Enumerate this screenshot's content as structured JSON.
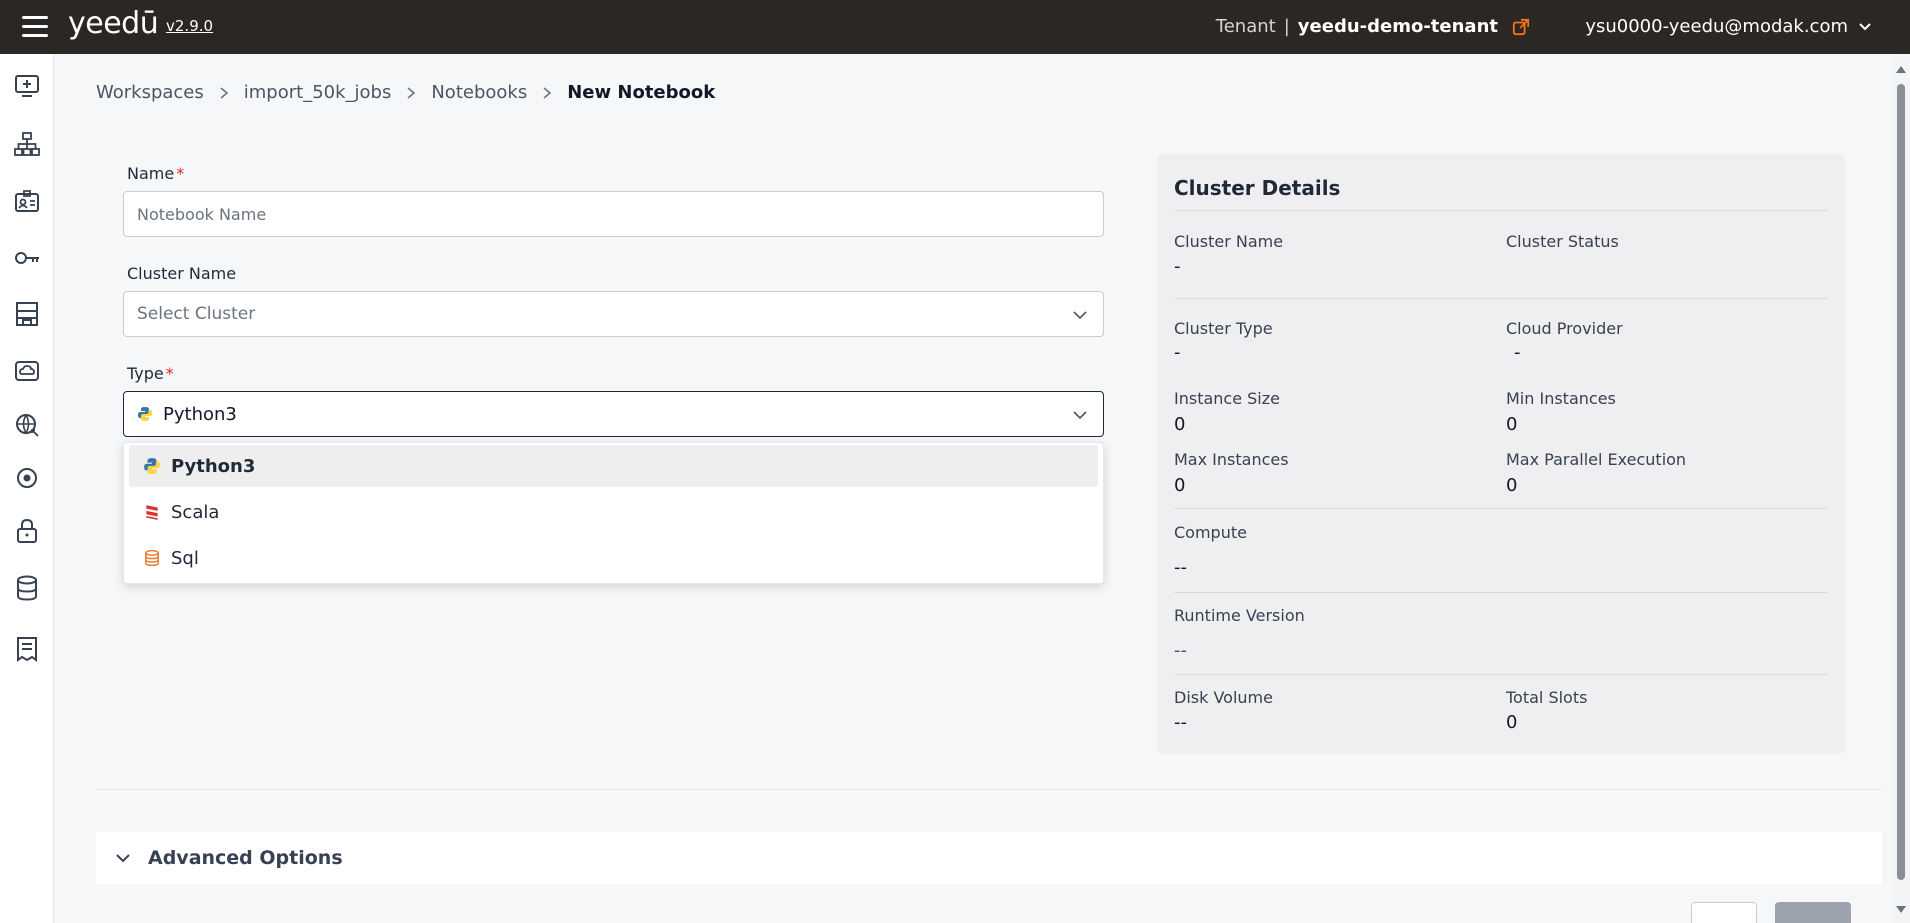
{
  "topbar": {
    "logo": "yeedū",
    "version": "v2.9.0",
    "tenant_label": "Tenant",
    "tenant_separator": "|",
    "tenant_name": "yeedu-demo-tenant",
    "user_email": "ysu0000-yeedu@modak.com"
  },
  "sidebar": {
    "icons": [
      "new-workspace-icon",
      "sitemap-icon",
      "id-card-icon",
      "key-icon",
      "building-icon",
      "cloud-icon",
      "globe-icon",
      "target-icon",
      "lock-icon",
      "database-icon",
      "receipt-icon"
    ]
  },
  "breadcrumb": {
    "items": [
      "Workspaces",
      "import_50k_jobs",
      "Notebooks"
    ],
    "current": "New Notebook"
  },
  "form": {
    "name_label": "Name",
    "name_placeholder": "Notebook Name",
    "cluster_label": "Cluster Name",
    "cluster_placeholder": "Select Cluster",
    "type_label": "Type",
    "type_value": "Python3",
    "required_mark": "*",
    "type_options": [
      "Python3",
      "Scala",
      "Sql"
    ]
  },
  "cluster_details": {
    "title": "Cluster Details",
    "cluster_name_label": "Cluster Name",
    "cluster_name_value": "-",
    "cluster_status_label": "Cluster Status",
    "cluster_status_value": "",
    "cluster_type_label": "Cluster Type",
    "cluster_type_value": "-",
    "cloud_provider_label": "Cloud Provider",
    "cloud_provider_value": "-",
    "instance_size_label": "Instance Size",
    "instance_size_value": "0",
    "min_instances_label": "Min Instances",
    "min_instances_value": "0",
    "max_instances_label": "Max Instances",
    "max_instances_value": "0",
    "max_parallel_label": "Max Parallel Execution",
    "max_parallel_value": "0",
    "compute_label": "Compute",
    "compute_value": "--",
    "runtime_label": "Runtime Version",
    "runtime_value": "--",
    "disk_label": "Disk Volume",
    "disk_value": "--",
    "slots_label": "Total Slots",
    "slots_value": "0"
  },
  "advanced": {
    "label": "Advanced Options"
  },
  "colors": {
    "topbar": "#2b2725",
    "accent_orange": "#f97316",
    "required_red": "#dc2626"
  }
}
